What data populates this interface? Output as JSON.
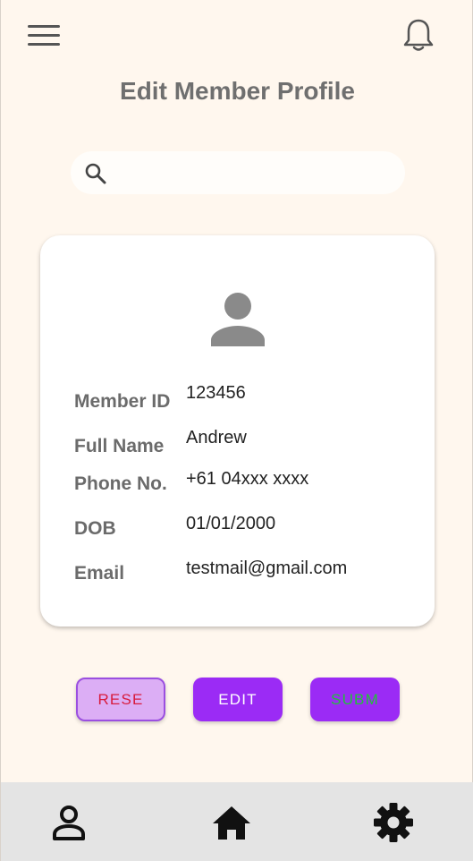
{
  "header": {
    "title": "Edit Member Profile",
    "menu_icon": "hamburger-menu-icon",
    "notification_icon": "bell-icon"
  },
  "search": {
    "icon": "search-icon",
    "value": "",
    "placeholder": ""
  },
  "profile": {
    "avatar_icon": "person-icon",
    "fields": [
      {
        "label": "Member ID",
        "value": "123456"
      },
      {
        "label": "Full Name",
        "value": "Andrew"
      },
      {
        "label": "Phone No.",
        "value": "+61 04xxx xxxx"
      },
      {
        "label": "DOB",
        "value": "01/01/2000"
      },
      {
        "label": "Email",
        "value": "testmail@gmail.com"
      }
    ]
  },
  "actions": {
    "reset_label": "RESE",
    "edit_label": "EDIT",
    "submit_label": "SUBM"
  },
  "nav": {
    "items": [
      {
        "icon": "profile-icon"
      },
      {
        "icon": "home-icon"
      },
      {
        "icon": "settings-gear-icon"
      }
    ]
  },
  "colors": {
    "background": "#fff7ee",
    "accent": "#9b2bf5",
    "reset_bg": "#dcaef5",
    "reset_text": "#d81b3c",
    "submit_text": "#22c03a"
  }
}
